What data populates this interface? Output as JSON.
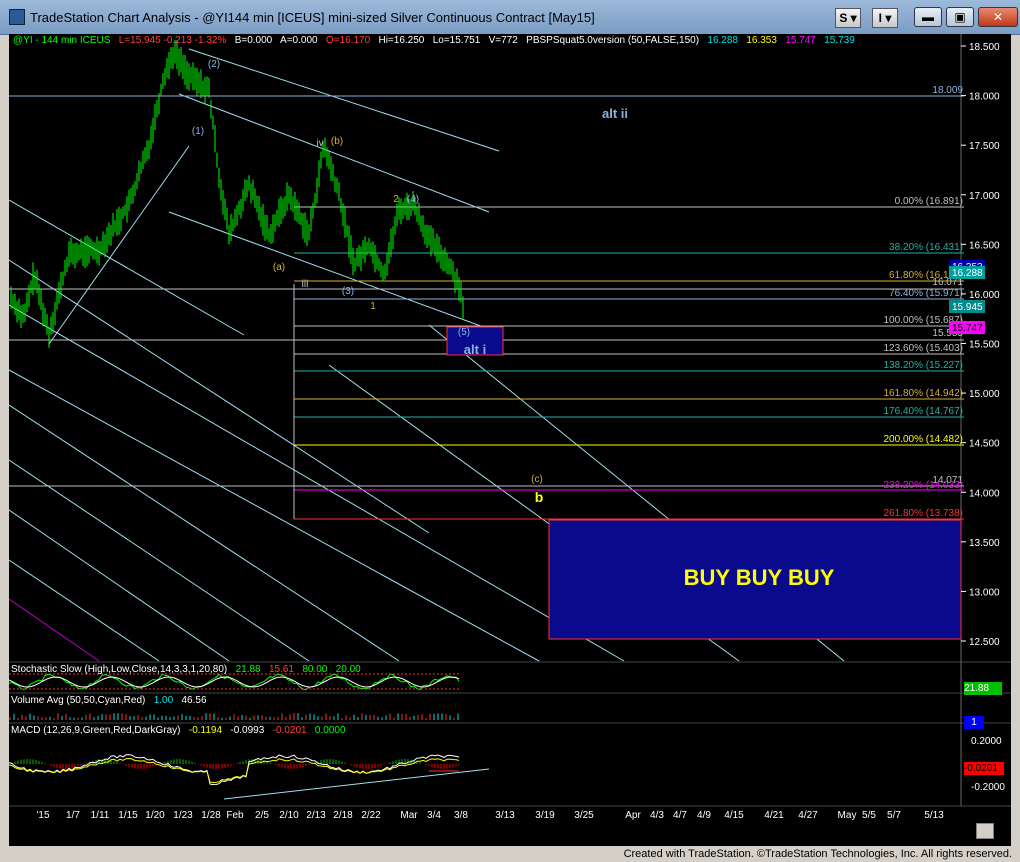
{
  "window": {
    "title": "TradeStation Chart Analysis - @YI144 min [ICEUS] mini-sized Silver Continuous Contract [May15]",
    "buttons": {
      "s": "S",
      "i": "I"
    },
    "controls": {
      "minimize": "▬",
      "maximize": "▣",
      "close": "✕"
    }
  },
  "header": {
    "symbol": "@YI - 144 min  ICEUS",
    "last": "L=15.945  -0.213  -1.32%",
    "b": "B=0.000",
    "a": "A=0.000",
    "open": "O=16.170",
    "high": "Hi=16.250",
    "low": "Lo=15.751",
    "volume": "V=772",
    "study": "PBSPSquat5.0version (50,FALSE,150)",
    "v1": "16.288",
    "v2": "16.353",
    "v3": "15.747",
    "v4": "15.739"
  },
  "price_axis": {
    "ticks": [
      "18.500",
      "18.000",
      "17.500",
      "17.000",
      "16.500",
      "16.000",
      "15.500",
      "15.000",
      "14.500",
      "14.000",
      "13.500",
      "13.000",
      "12.500"
    ],
    "flags": [
      {
        "text": "16.353",
        "bg": "#0000aa",
        "fg": "#ffffff"
      },
      {
        "text": "16.288",
        "bg": "#00a0a0",
        "fg": "#ffffff"
      },
      {
        "text": "15.945",
        "bg": "#008b8b",
        "fg": "#ffffff"
      },
      {
        "text": "15.747",
        "bg": "#ff00ff",
        "fg": "#000000"
      }
    ]
  },
  "levels": [
    {
      "text": "18.009",
      "color": "#8ab4e0"
    },
    {
      "text": "0.00% (16.891)",
      "color": "#c0c0c0"
    },
    {
      "text": "38.20% (16.431)",
      "color": "#20b2aa"
    },
    {
      "text": "61.80% (16.147)",
      "color": "#d4af37"
    },
    {
      "text": "16.071",
      "color": "#c0c0c0"
    },
    {
      "text": "76.40% (15.971)",
      "color": "#8ab4e0"
    },
    {
      "text": "100.00% (15.687)",
      "color": "#c0c0c0"
    },
    {
      "text": "15.553",
      "color": "#c0c0c0"
    },
    {
      "text": "123.60% (15.403)",
      "color": "#c0c0c0"
    },
    {
      "text": "138.20% (15.227)",
      "color": "#20b2aa"
    },
    {
      "text": "161.80% (14.942)",
      "color": "#d4af37"
    },
    {
      "text": "176.40% (14.767)",
      "color": "#20b2aa"
    },
    {
      "text": "200.00% (14.482)",
      "color": "#ffff00"
    },
    {
      "text": "14.071",
      "color": "#c0c0c0"
    },
    {
      "text": "238.20% (14.033)",
      "color": "#ff00ff"
    },
    {
      "text": "261.80% (13.738)",
      "color": "#ff3030"
    }
  ],
  "wave_labels": [
    {
      "text": "(2)",
      "color": "#8ab4e0"
    },
    {
      "text": "(1)",
      "color": "#8ab4e0"
    },
    {
      "text": "iv",
      "color": "#c0c0c0"
    },
    {
      "text": "(b)",
      "color": "#d4af37"
    },
    {
      "text": "2",
      "color": "#d4af37"
    },
    {
      "text": "(4)",
      "color": "#8ab4e0"
    },
    {
      "text": "(a)",
      "color": "#d4af37"
    },
    {
      "text": "iii",
      "color": "#c0c0c0"
    },
    {
      "text": "(3)",
      "color": "#8ab4e0"
    },
    {
      "text": "1",
      "color": "#d4af37"
    },
    {
      "text": "(5)",
      "color": "#8ab4e0"
    },
    {
      "text": "(c)",
      "color": "#d4af37"
    },
    {
      "text": "b",
      "color": "#ffff00"
    }
  ],
  "annotations": {
    "alt_ii": "alt ii",
    "alt_i": "alt i",
    "buy": "BUY BUY BUY"
  },
  "indicators": {
    "stochastic": {
      "label": "Stochastic Slow (High,Low,Close,14,3,3,1,20,80)",
      "v1": "21.88",
      "v2": "15.61",
      "v3": "80.00",
      "v4": "20.00",
      "axis_flag": "21.88"
    },
    "volume": {
      "label": "Volume Avg (50,50,Cyan,Red)",
      "v1": "1.00",
      "v2": "46.56",
      "axis_flag": "1"
    },
    "macd": {
      "label": "MACD (12,26,9,Green,Red,DarkGray)",
      "v1": "-0.1194",
      "v2": "-0.0993",
      "v3": "-0.0201",
      "v4": "0.0000",
      "axis_ticks": [
        "0.2000",
        "-0.2000"
      ],
      "axis_flag": "-0.0201"
    }
  },
  "time_axis": [
    "'15",
    "1/7",
    "1/11",
    "1/15",
    "1/20",
    "1/23",
    "1/28",
    "Feb",
    "2/5",
    "2/10",
    "2/13",
    "2/18",
    "2/22",
    "Mar",
    "3/4",
    "3/8",
    "3/13",
    "3/19",
    "3/25",
    "Apr",
    "4/3",
    "4/7",
    "4/9",
    "4/15",
    "4/21",
    "4/27",
    "May",
    "5/5",
    "5/7",
    "5/13"
  ],
  "footer": "Created with TradeStation. ©TradeStation Technologies, Inc. All rights reserved."
}
